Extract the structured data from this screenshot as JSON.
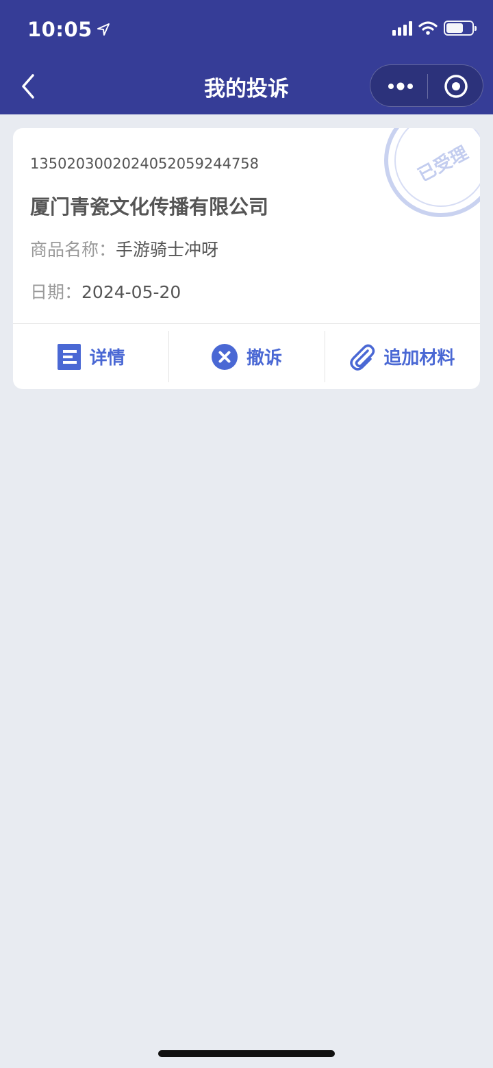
{
  "status_bar": {
    "time": "10:05"
  },
  "nav": {
    "title": "我的投诉"
  },
  "complaint": {
    "case_number": "1350203002024052059244758",
    "company": "厦门青瓷文化传播有限公司",
    "product_label": "商品名称：",
    "product_value": "手游骑士冲呀",
    "date_label": "日期：",
    "date_value": "2024-05-20",
    "stamp_text": "已受理"
  },
  "actions": {
    "details": "详情",
    "withdraw": "撤诉",
    "add_material": "追加材料"
  },
  "colors": {
    "header": "#363d97",
    "accent": "#4a68d4",
    "background": "#e8ebf1",
    "stamp": "#c9d2f0"
  },
  "icons": [
    "location-arrow-icon",
    "signal-icon",
    "wifi-icon",
    "battery-icon",
    "back-chevron-icon",
    "more-dots-icon",
    "close-target-icon",
    "document-icon",
    "x-circle-icon",
    "paperclip-icon"
  ]
}
